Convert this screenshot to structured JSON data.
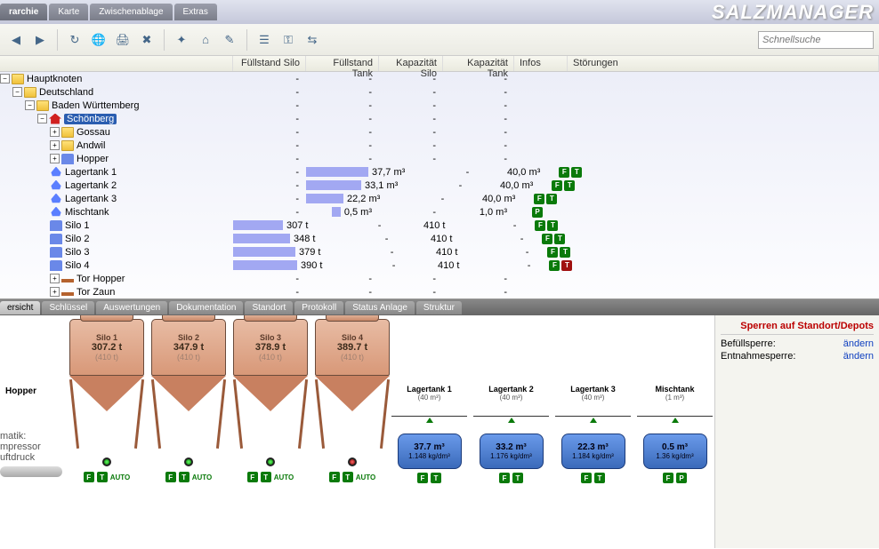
{
  "brand": "SALZMANAGER",
  "menu": [
    "rarchie",
    "Karte",
    "Zwischenablage",
    "Extras"
  ],
  "search_placeholder": "Schnellsuche",
  "toolbar_icons": [
    "back-icon",
    "fwd-icon",
    "refresh-icon",
    "globe-icon",
    "print-icon",
    "delete-icon",
    "spark-icon",
    "home-icon",
    "edit-icon",
    "list-icon",
    "key-icon",
    "switch-icon"
  ],
  "columns": {
    "tree": "",
    "fs": "Füllstand Silo",
    "ft": "Füllstand Tank",
    "ks": "Kapazität Silo",
    "kt": "Kapazität Tank",
    "in": "Infos",
    "st": "Störungen"
  },
  "tree": {
    "root": "Hauptknoten",
    "country": "Deutschland",
    "region": "Baden Württemberg",
    "site": "Schönberg",
    "folders": [
      "Gossau",
      "Andwil",
      "Hopper"
    ],
    "tanks": [
      {
        "name": "Lagertank 1",
        "ft": "37,7 m³",
        "kt": "40,0 m³",
        "b": 70,
        "badges": [
          "F",
          "T"
        ]
      },
      {
        "name": "Lagertank 2",
        "ft": "33,1 m³",
        "kt": "40,0 m³",
        "b": 62,
        "badges": [
          "F",
          "T"
        ]
      },
      {
        "name": "Lagertank 3",
        "ft": "22,2 m³",
        "kt": "40,0 m³",
        "b": 42,
        "badges": [
          "F",
          "T"
        ]
      },
      {
        "name": "Mischtank",
        "ft": "0,5 m³",
        "kt": "1,0 m³",
        "b": 10,
        "badges": [
          "P"
        ]
      }
    ],
    "silos": [
      {
        "name": "Silo 1",
        "fs": "307 t",
        "ks": "410 t",
        "b": 56,
        "bt": false
      },
      {
        "name": "Silo 2",
        "fs": "348 t",
        "ks": "410 t",
        "b": 64,
        "bt": false
      },
      {
        "name": "Silo 3",
        "fs": "379 t",
        "ks": "410 t",
        "b": 70,
        "bt": false
      },
      {
        "name": "Silo 4",
        "fs": "390 t",
        "ks": "410 t",
        "b": 72,
        "bt": true
      }
    ],
    "gates": [
      "Tor Hopper",
      "Tor Zaun"
    ]
  },
  "subtabs": [
    "ersicht",
    "Schlüssel",
    "Auswertungen",
    "Dokumentation",
    "Standort",
    "Protokoll",
    "Status Anlage",
    "Struktur"
  ],
  "side": {
    "title": "Sperren auf Standort/Depots",
    "fill_label": "Befüllsperre:",
    "take_label": "Entnahmesperre:",
    "change": "ändern"
  },
  "hopper_label": "Hopper",
  "sys_labels": [
    "matik:",
    "mpressor",
    "uftdruck"
  ],
  "auto": "AUTO",
  "silos_g": [
    {
      "name": "Silo 1",
      "wt": "307.2 t",
      "cap": "(410 t)",
      "red": false
    },
    {
      "name": "Silo 2",
      "wt": "347.9 t",
      "cap": "(410 t)",
      "red": false
    },
    {
      "name": "Silo 3",
      "wt": "378.9 t",
      "cap": "(410 t)",
      "red": false
    },
    {
      "name": "Silo 4",
      "wt": "389.7 t",
      "cap": "(410 t)",
      "red": true
    }
  ],
  "tanks_g": [
    {
      "name": "Lagertank 1",
      "cap": "(40 m³)",
      "v": "37.7 m³",
      "d": "1.148 kg/dm³"
    },
    {
      "name": "Lagertank 2",
      "cap": "(40 m³)",
      "v": "33.2 m³",
      "d": "1.176 kg/dm³"
    },
    {
      "name": "Lagertank 3",
      "cap": "(40 m³)",
      "v": "22.3 m³",
      "d": "1.184 kg/dm³"
    },
    {
      "name": "Mischtank",
      "cap": "(1 m³)",
      "v": "0.5 m³",
      "d": "1.36 kg/dm³"
    }
  ]
}
